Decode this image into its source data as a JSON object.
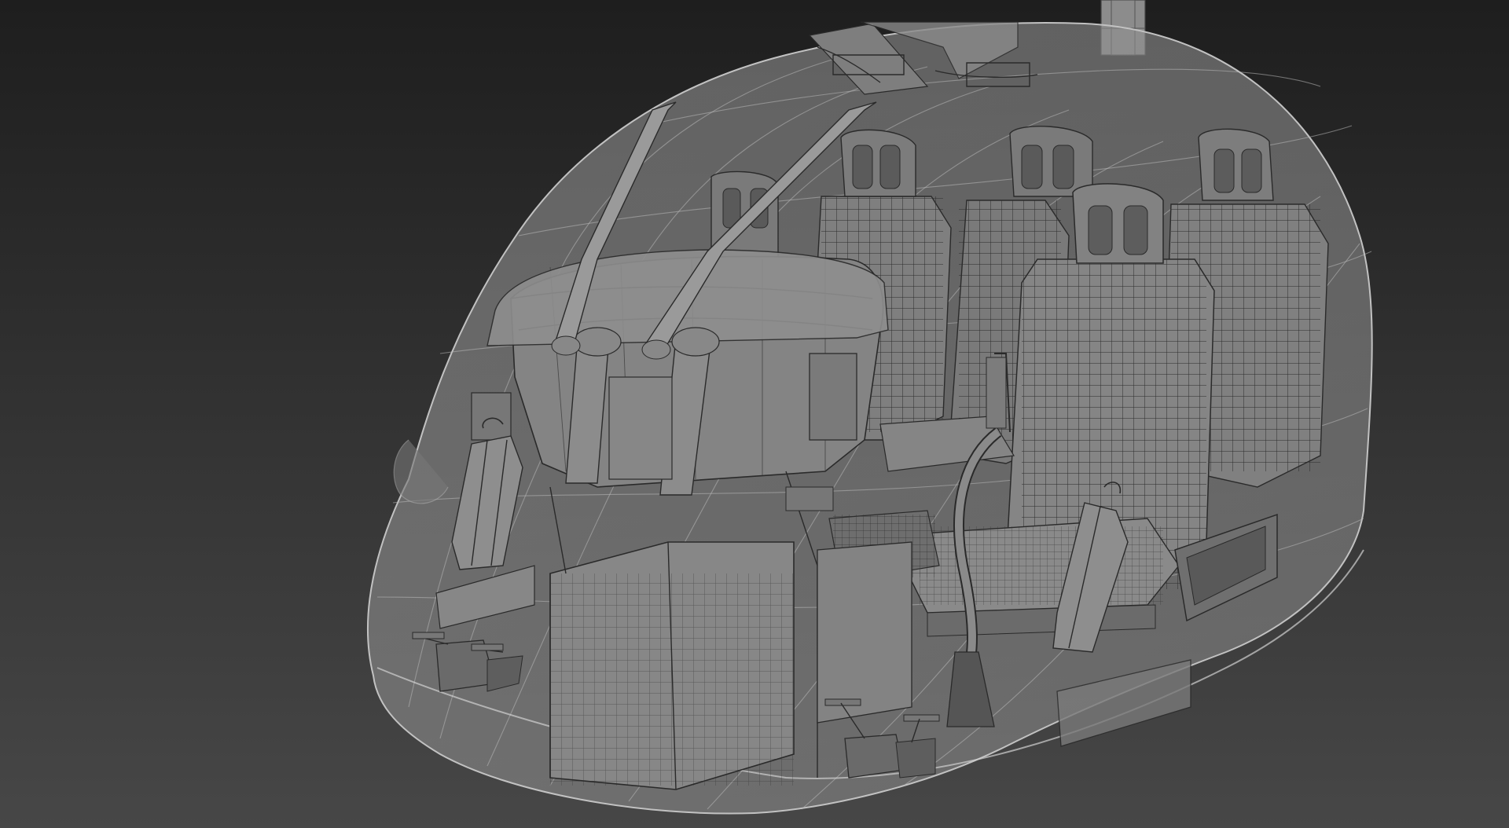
{
  "viewport": {
    "background_top": "#1e1e1e",
    "background_bottom": "#474747",
    "shell_fill": "#8a8a8a",
    "shell_line": "#bdbdbd",
    "mesh_fill": "#7a7a7a",
    "mesh_line": "#2b2b2b"
  },
  "objects": {
    "shell": "canopy-shell",
    "seats": [
      "front-left-seat",
      "front-right-seat",
      "rear-seat-1",
      "rear-seat-2",
      "rear-seat-3"
    ],
    "wipers": [
      "left-wiper",
      "right-wiper"
    ],
    "extinguishers": [
      "left-extinguisher",
      "right-extinguisher"
    ]
  }
}
